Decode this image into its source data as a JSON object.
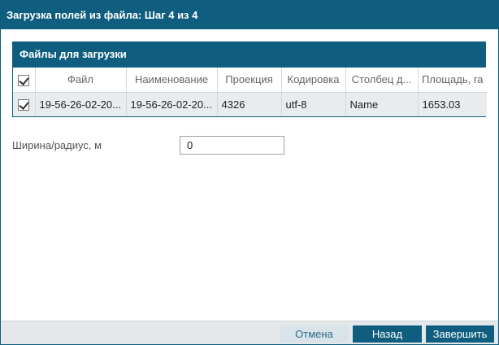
{
  "dialog": {
    "title": "Загрузка полей из файла: Шаг 4 из 4"
  },
  "files_panel": {
    "title": "Файлы для загрузки",
    "columns": [
      "Файл",
      "Наименование",
      "Проекция",
      "Кодировка",
      "Столбец д...",
      "Площадь, га"
    ],
    "rows": [
      {
        "checked": true,
        "cells": [
          "19-56-26-02-20...",
          "19-56-26-02-20...",
          "4326",
          "utf-8",
          "Name",
          "1653.03"
        ]
      }
    ]
  },
  "width_field": {
    "label": "Ширина/радиус, м",
    "value": "0"
  },
  "footer": {
    "cancel_label": "Отмена",
    "back_label": "Назад",
    "finish_label": "Завершить"
  }
}
